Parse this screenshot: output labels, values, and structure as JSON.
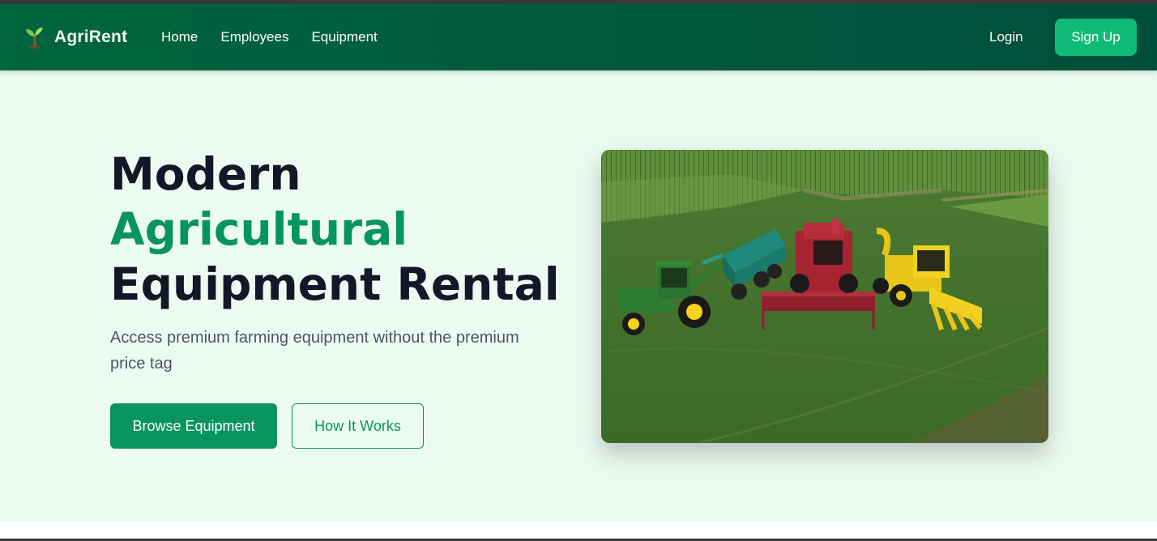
{
  "brand": {
    "name": "AgriRent",
    "icon": "seedling-icon"
  },
  "nav": {
    "links": [
      "Home",
      "Employees",
      "Equipment"
    ],
    "login_label": "Login",
    "signup_label": "Sign Up"
  },
  "hero": {
    "title_line1": "Modern",
    "title_line2": "Agricultural",
    "title_line3": "Equipment Rental",
    "subtitle": "Access premium farming equipment without the premium price tag",
    "primary_button": "Browse Equipment",
    "secondary_button": "How It Works",
    "image_subject": "tractor, grain cart, combine harvester and forage harvester on a green field"
  },
  "colors": {
    "nav_bg": "#015a3d",
    "accent": "#079461",
    "signup_bg": "#10bb78",
    "hero_bg": "#ecfbf2",
    "headline": "#111827"
  }
}
